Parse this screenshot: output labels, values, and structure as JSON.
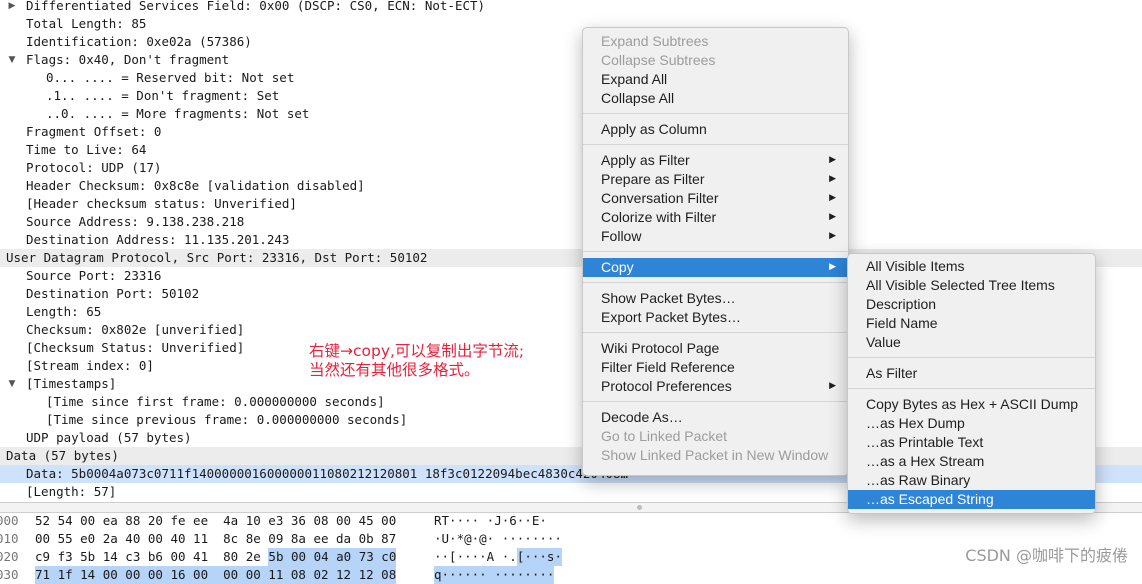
{
  "tree_rows": [
    {
      "indent": 26,
      "text": "Differentiated Services Field: 0x00 (DSCP: CS0, ECN: Not-ECT)",
      "arrow": "▶",
      "style": ""
    },
    {
      "indent": 26,
      "text": "Total Length: 85",
      "arrow": "",
      "style": ""
    },
    {
      "indent": 26,
      "text": "Identification: 0xe02a (57386)",
      "arrow": "",
      "style": ""
    },
    {
      "indent": 26,
      "text": "Flags: 0x40, Don't fragment",
      "arrow": "▼",
      "style": ""
    },
    {
      "indent": 46,
      "text": "0... .... = Reserved bit: Not set",
      "arrow": "",
      "style": ""
    },
    {
      "indent": 46,
      "text": ".1.. .... = Don't fragment: Set",
      "arrow": "",
      "style": ""
    },
    {
      "indent": 46,
      "text": "..0. .... = More fragments: Not set",
      "arrow": "",
      "style": ""
    },
    {
      "indent": 26,
      "text": "Fragment Offset: 0",
      "arrow": "",
      "style": ""
    },
    {
      "indent": 26,
      "text": "Time to Live: 64",
      "arrow": "",
      "style": ""
    },
    {
      "indent": 26,
      "text": "Protocol: UDP (17)",
      "arrow": "",
      "style": ""
    },
    {
      "indent": 26,
      "text": "Header Checksum: 0x8c8e [validation disabled]",
      "arrow": "",
      "style": ""
    },
    {
      "indent": 26,
      "text": "[Header checksum status: Unverified]",
      "arrow": "",
      "style": ""
    },
    {
      "indent": 26,
      "text": "Source Address: 9.138.238.218",
      "arrow": "",
      "style": ""
    },
    {
      "indent": 26,
      "text": "Destination Address: 11.135.201.243",
      "arrow": "",
      "style": ""
    },
    {
      "indent": 6,
      "text": "User Datagram Protocol, Src Port: 23316, Dst Port: 50102",
      "arrow": "",
      "style": "hdr"
    },
    {
      "indent": 26,
      "text": "Source Port: 23316",
      "arrow": "",
      "style": ""
    },
    {
      "indent": 26,
      "text": "Destination Port: 50102",
      "arrow": "",
      "style": ""
    },
    {
      "indent": 26,
      "text": "Length: 65",
      "arrow": "",
      "style": ""
    },
    {
      "indent": 26,
      "text": "Checksum: 0x802e [unverified]",
      "arrow": "",
      "style": ""
    },
    {
      "indent": 26,
      "text": "[Checksum Status: Unverified]",
      "arrow": "",
      "style": ""
    },
    {
      "indent": 26,
      "text": "[Stream index: 0]",
      "arrow": "",
      "style": ""
    },
    {
      "indent": 26,
      "text": "[Timestamps]",
      "arrow": "▼",
      "style": ""
    },
    {
      "indent": 46,
      "text": "[Time since first frame: 0.000000000 seconds]",
      "arrow": "",
      "style": ""
    },
    {
      "indent": 46,
      "text": "[Time since previous frame: 0.000000000 seconds]",
      "arrow": "",
      "style": ""
    },
    {
      "indent": 26,
      "text": "UDP payload (57 bytes)",
      "arrow": "",
      "style": ""
    },
    {
      "indent": 6,
      "text": "Data (57 bytes)",
      "arrow": "",
      "style": "hdr"
    },
    {
      "indent": 26,
      "text": "Data: 5b0004a073c0711f140000001600000011080212120801 18f3c0122094bec4830c420408…",
      "arrow": "",
      "style": "sel"
    },
    {
      "indent": 26,
      "text": "[Length: 57]",
      "arrow": "",
      "style": ""
    }
  ],
  "hex_rows": [
    {
      "offset": "000",
      "bytes": "52 54 00 ea 88 20 fe ee  4a 10 e3 36 08 00 45 00",
      "ascii": "RT···· ·J·6··E·",
      "hl_bytes": "",
      "hl_ascii": ""
    },
    {
      "offset": "010",
      "bytes": "00 55 e0 2a 40 00 40 11  8c 8e 09 8a ee da 0b 87",
      "ascii": "·U·*@·@· ········",
      "hl_bytes": "",
      "hl_ascii": ""
    },
    {
      "offset": "020",
      "bytes": "c9 f3 5b 14 c3 b6 00 41  80 2e ",
      "ascii": "··[····A ·.",
      "hl_bytes": "5b 00 04 a0 73 c0",
      "hl_ascii": "[···s·"
    },
    {
      "offset": "030",
      "bytes": "",
      "ascii": "",
      "hl_bytes": "71 1f 14 00 00 00 16 00  00 00 11 08 02 12 12 08",
      "hl_ascii": "q······ ········"
    }
  ],
  "annotation": {
    "line1": "右键→copy,可以复制出字节流;",
    "line2": "当然还有其他很多格式。"
  },
  "watermark": "CSDN @咖啡下的疲倦",
  "context_menu": {
    "items": [
      {
        "label": "Expand Subtrees",
        "disabled": true,
        "submenu": false,
        "active": false
      },
      {
        "label": "Collapse Subtrees",
        "disabled": true,
        "submenu": false,
        "active": false
      },
      {
        "label": "Expand All",
        "disabled": false,
        "submenu": false,
        "active": false
      },
      {
        "label": "Collapse All",
        "disabled": false,
        "submenu": false,
        "active": false
      },
      {
        "sep": true
      },
      {
        "label": "Apply as Column",
        "disabled": false,
        "submenu": false,
        "active": false
      },
      {
        "sep": true
      },
      {
        "label": "Apply as Filter",
        "disabled": false,
        "submenu": true,
        "active": false
      },
      {
        "label": "Prepare as Filter",
        "disabled": false,
        "submenu": true,
        "active": false
      },
      {
        "label": "Conversation Filter",
        "disabled": false,
        "submenu": true,
        "active": false
      },
      {
        "label": "Colorize with Filter",
        "disabled": false,
        "submenu": true,
        "active": false
      },
      {
        "label": "Follow",
        "disabled": false,
        "submenu": true,
        "active": false
      },
      {
        "sep": true
      },
      {
        "label": "Copy",
        "disabled": false,
        "submenu": true,
        "active": true
      },
      {
        "sep": true
      },
      {
        "label": "Show Packet Bytes…",
        "disabled": false,
        "submenu": false,
        "active": false
      },
      {
        "label": "Export Packet Bytes…",
        "disabled": false,
        "submenu": false,
        "active": false
      },
      {
        "sep": true
      },
      {
        "label": "Wiki Protocol Page",
        "disabled": false,
        "submenu": false,
        "active": false
      },
      {
        "label": "Filter Field Reference",
        "disabled": false,
        "submenu": false,
        "active": false
      },
      {
        "label": "Protocol Preferences",
        "disabled": false,
        "submenu": true,
        "active": false
      },
      {
        "sep": true
      },
      {
        "label": "Decode As…",
        "disabled": false,
        "submenu": false,
        "active": false
      },
      {
        "label": "Go to Linked Packet",
        "disabled": true,
        "submenu": false,
        "active": false
      },
      {
        "label": "Show Linked Packet in New Window",
        "disabled": true,
        "submenu": false,
        "active": false
      }
    ]
  },
  "copy_submenu": {
    "items": [
      {
        "label": "All Visible Items",
        "active": false
      },
      {
        "label": "All Visible Selected Tree Items",
        "active": false
      },
      {
        "label": "Description",
        "active": false
      },
      {
        "label": "Field Name",
        "active": false
      },
      {
        "label": "Value",
        "active": false
      },
      {
        "sep": true
      },
      {
        "label": "As Filter",
        "active": false
      },
      {
        "sep": true
      },
      {
        "label": "Copy Bytes as Hex + ASCII Dump",
        "active": false
      },
      {
        "label": "…as Hex Dump",
        "active": false
      },
      {
        "label": "…as Printable Text",
        "active": false
      },
      {
        "label": "…as a Hex Stream",
        "active": false
      },
      {
        "label": "…as Raw Binary",
        "active": false
      },
      {
        "label": "…as Escaped String",
        "active": true
      }
    ]
  },
  "colors": {
    "menu_highlight": "#2e84d7",
    "row_selected": "#cfe2fb",
    "byte_highlight": "#b6d3f8",
    "annotation": "#e8213c"
  },
  "icons": {
    "submenu_arrow": "▶",
    "collapsed_arrow": "▶",
    "expanded_arrow": "▼"
  }
}
